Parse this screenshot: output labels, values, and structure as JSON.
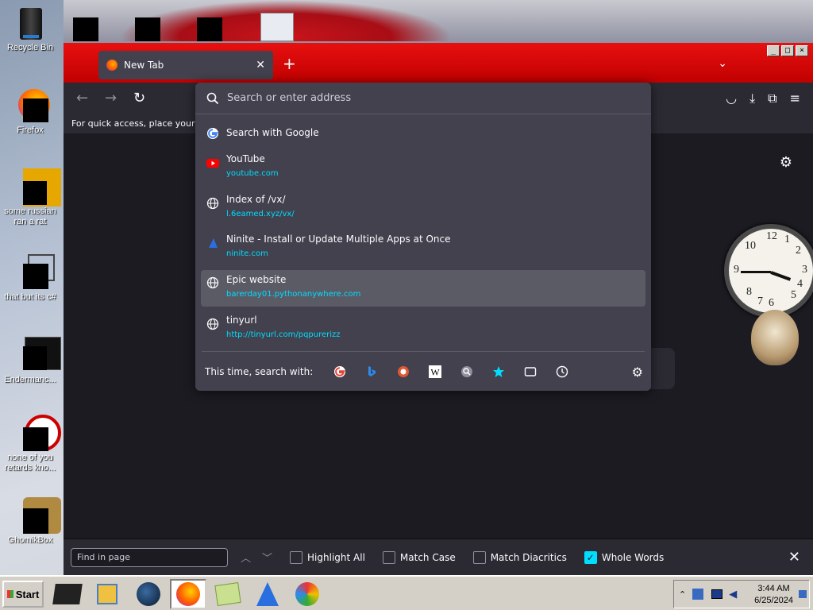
{
  "desktop": {
    "icons": [
      {
        "label": "Recycle Bin",
        "icon": "recycle-bin-icon"
      },
      {
        "label": "Firefox",
        "icon": "firefox-icon"
      },
      {
        "label": "some russian ran a rat",
        "icon": "app-icon"
      },
      {
        "label": "that but its c#",
        "icon": "app-icon"
      },
      {
        "label": "Endermanc...",
        "icon": "app-icon"
      },
      {
        "label": "none of you retards kno...",
        "icon": "app-icon"
      },
      {
        "label": "GhomikBox",
        "icon": "app-icon"
      }
    ]
  },
  "browser": {
    "tab": {
      "label": "New Tab"
    },
    "new_tab_plus": "+",
    "bookmarks_hint": "For quick access, place your boo",
    "url_popup": {
      "placeholder": "Search or enter address",
      "search_with": "Search with Google",
      "results": [
        {
          "title": "YouTube",
          "url": "youtube.com",
          "icon": "youtube-icon"
        },
        {
          "title": "Index of /vx/",
          "url": "l.6eamed.xyz/vx/",
          "icon": "globe-icon"
        },
        {
          "title": "Ninite - Install or Update Multiple Apps at Once",
          "url": "ninite.com",
          "icon": "ninite-icon"
        },
        {
          "title": "Epic website",
          "url": "barerday01.pythonanywhere.com",
          "icon": "globe-icon",
          "selected": true
        },
        {
          "title": "tinyurl",
          "url": "http://tinyurl.com/pqpurerizz",
          "icon": "globe-icon"
        }
      ],
      "one_off_label": "This time, search with:",
      "engines": [
        "google-icon",
        "bing-icon",
        "duckduckgo-icon",
        "wikipedia-icon",
        "search-icon",
        "bookmarks-star-icon",
        "tabs-icon",
        "history-icon"
      ]
    },
    "find_bar": {
      "placeholder": "Find in page",
      "highlight_all": "Highlight All",
      "match_case": "Match Case",
      "match_diacritics": "Match Diacritics",
      "whole_words": "Whole Words",
      "whole_words_checked": true
    }
  },
  "taskbar": {
    "start_label": "Start",
    "time": "3:44 AM",
    "date": "6/25/2024"
  }
}
